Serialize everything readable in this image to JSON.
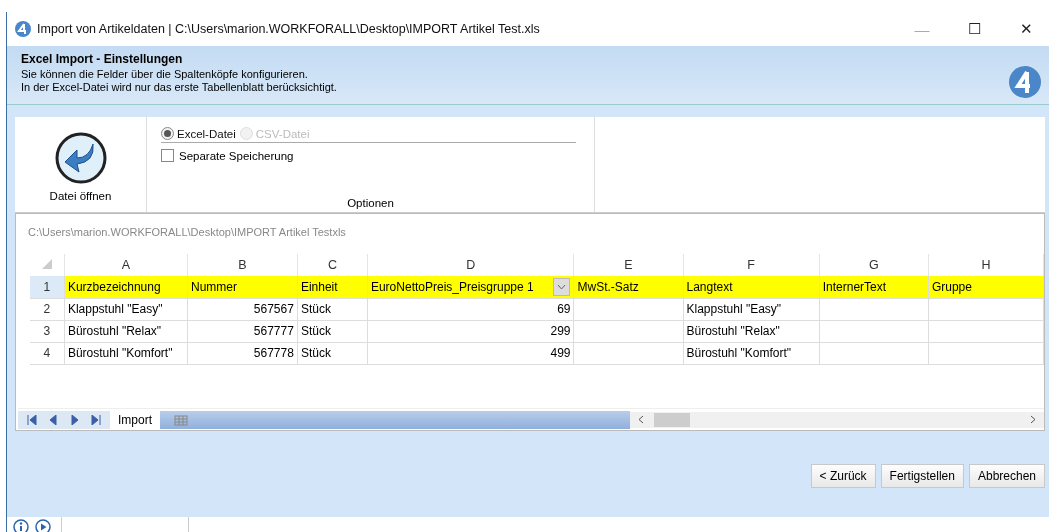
{
  "window": {
    "title": "Import von Artikeldaten | C:\\Users\\marion.WORKFORALL\\Desktop\\IMPORT Artikel Test.xls",
    "controls": [
      "—",
      "☐",
      "✕"
    ]
  },
  "header": {
    "title": "Excel Import - Einstellungen",
    "lines": [
      "Sie können die Felder über die Spaltenköpfe konfigurieren.",
      "In der Excel-Datei wird nur das erste Tabellenblatt berücksichtigt."
    ]
  },
  "ribbon": {
    "open_button": "Datei öffnen",
    "options": [
      {
        "label": "Excel-Datei",
        "selected": true,
        "disabled": false
      },
      {
        "label": "CSV-Datei",
        "selected": false,
        "disabled": true
      }
    ],
    "separate": {
      "label": "Separate Speicherung",
      "checked": false
    },
    "group_label": "Optionen"
  },
  "path": "C:\\Users\\marion.WORKFORALL\\Desktop\\IMPORT Artikel Testxls",
  "sheet": {
    "columns": [
      {
        "letter": "A",
        "numeric": false,
        "dropdown": false
      },
      {
        "letter": "B",
        "numeric": true,
        "dropdown": false
      },
      {
        "letter": "C",
        "numeric": false,
        "dropdown": false
      },
      {
        "letter": "D",
        "numeric": true,
        "dropdown": true
      },
      {
        "letter": "E",
        "dropdown": false
      },
      {
        "letter": "F",
        "numeric": false,
        "dropdown": false
      },
      {
        "letter": "G",
        "dropdown": false
      },
      {
        "letter": "H",
        "dropdown": false
      }
    ],
    "rows": [
      {
        "number": "1",
        "kind": "mapping",
        "cells": [
          "Kurzbezeichnung",
          "Nummer",
          "Einheit",
          "EuroNettoPreis_Preisgruppe 1",
          "MwSt.-Satz",
          "Langtext",
          "InternerText",
          "Gruppe"
        ]
      },
      {
        "number": "2",
        "kind": "data",
        "cells": [
          "Klappstuhl \"Easy\"",
          "567567",
          "Stück",
          "69",
          "",
          "Klappstuhl \"Easy\"",
          "",
          ""
        ]
      },
      {
        "number": "3",
        "kind": "data",
        "cells": [
          "Bürostuhl \"Relax\"",
          "567777",
          "Stück",
          "299",
          "",
          "Bürostuhl \"Relax\"",
          "",
          ""
        ]
      },
      {
        "number": "4",
        "kind": "data",
        "cells": [
          "Bürostuhl \"Komfort\"",
          "567778",
          "Stück",
          "499",
          "",
          "Bürostuhl \"Komfort\"",
          "",
          ""
        ]
      }
    ],
    "tabs": [
      {
        "label": "Import",
        "selected": true
      }
    ]
  },
  "buttons": [
    "< Zurück",
    "Fertigstellen",
    "Abbrechen"
  ]
}
